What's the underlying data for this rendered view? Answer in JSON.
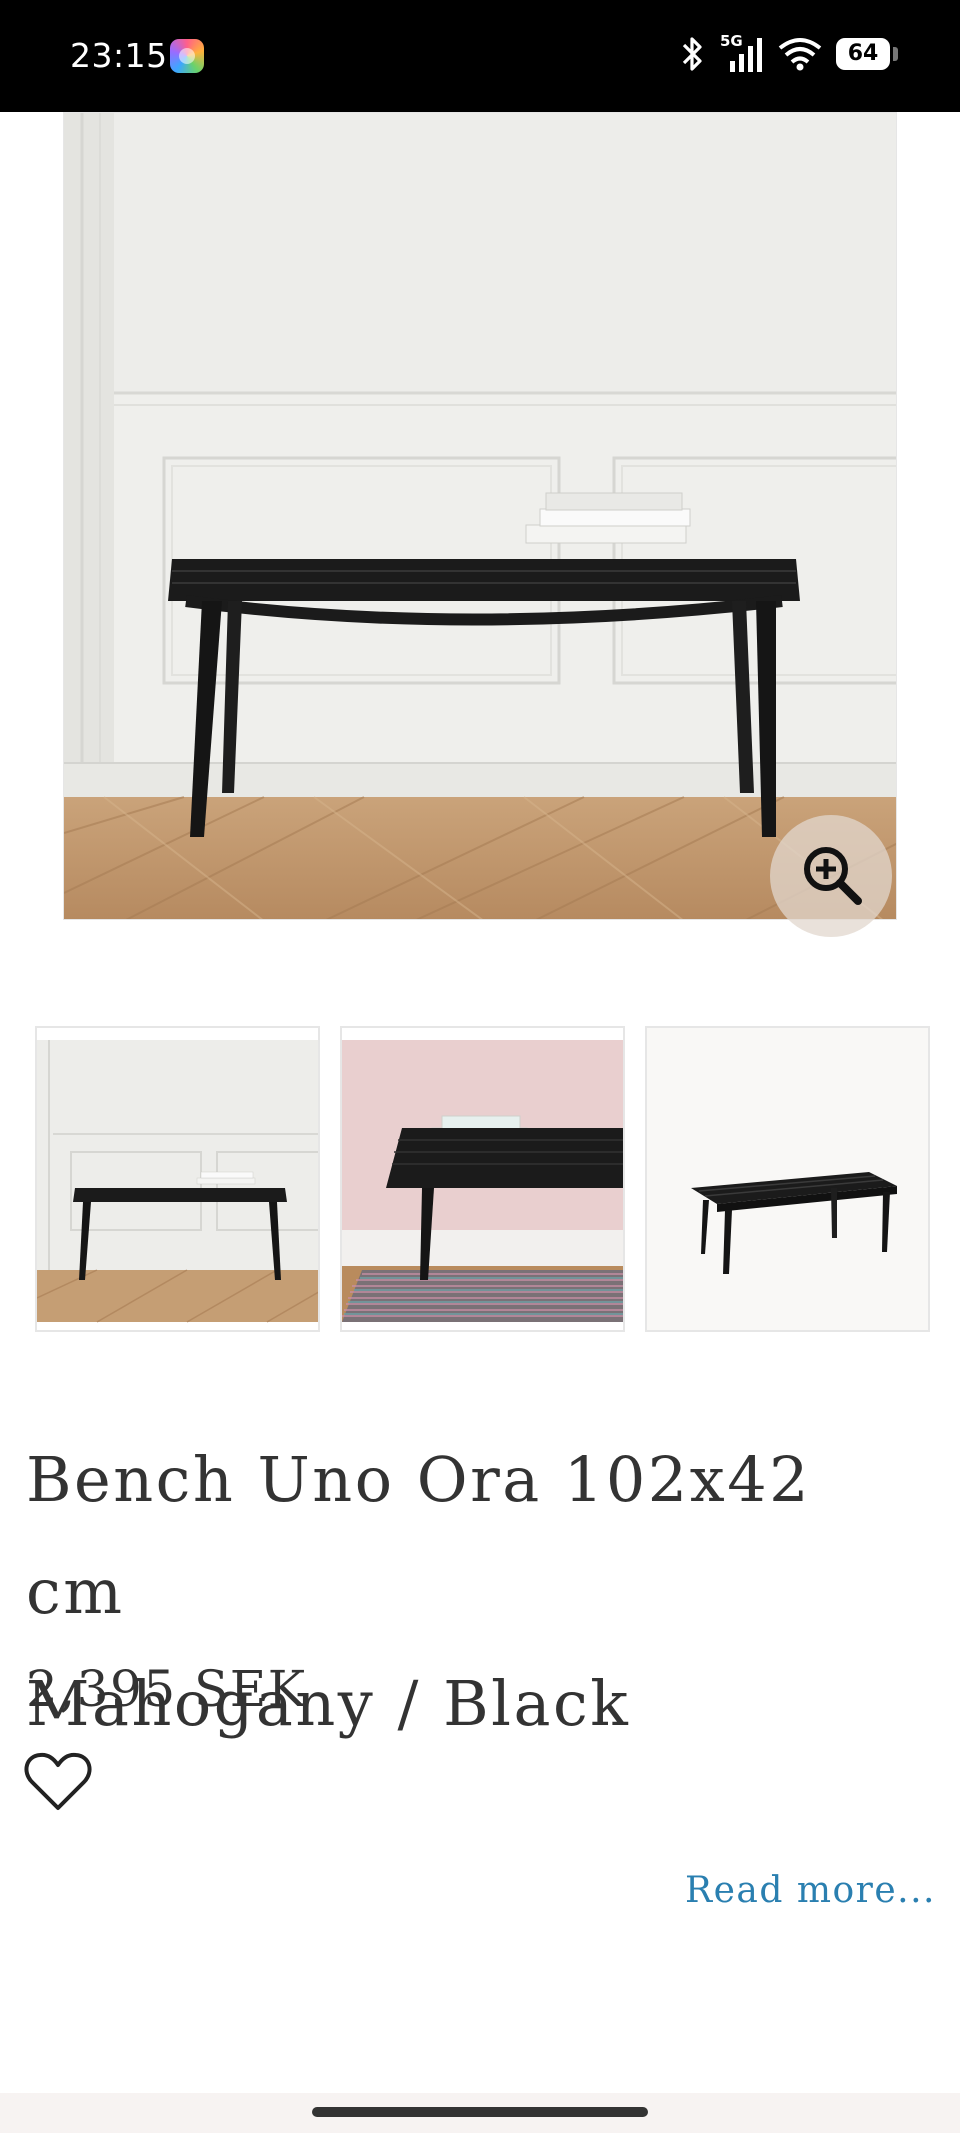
{
  "status_bar": {
    "time": "23:15",
    "network": "5G",
    "battery": "64",
    "icons": [
      "app-badge-icon",
      "bluetooth-icon",
      "signal-icon",
      "wifi-icon",
      "battery-icon"
    ]
  },
  "product": {
    "title_line1": "Bench Uno Ora 102x42 cm",
    "title_line2": "Mahogany / Black",
    "price": "2,395 SEK",
    "read_more": "Read more..."
  },
  "gallery": {
    "thumbnail_count": 3,
    "zoom_icon": "zoom-in-icon",
    "wishlist_icon": "heart-outline-icon"
  },
  "colors": {
    "text": "#333333",
    "link": "#2a7fb0",
    "status_bar": "#000000"
  }
}
